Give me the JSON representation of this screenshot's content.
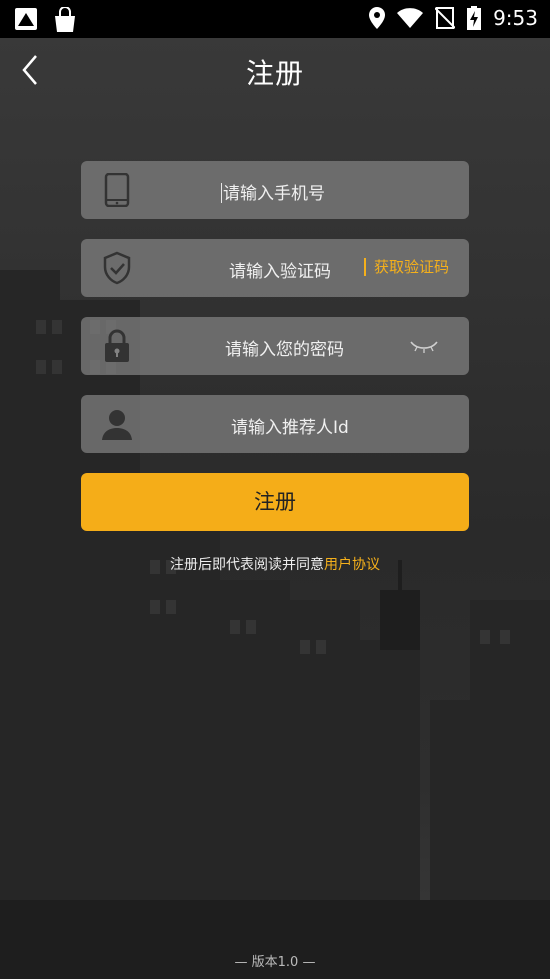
{
  "status_bar": {
    "time": "9:53",
    "left_icons": [
      "app-notification-icon",
      "shopping-bag-icon"
    ],
    "right_icons": [
      "location-icon",
      "wifi-icon",
      "no-sim-icon",
      "battery-charging-icon"
    ]
  },
  "header": {
    "title": "注册",
    "back_icon": "chevron-left-icon"
  },
  "form": {
    "phone": {
      "placeholder": "请输入手机号",
      "icon": "phone-icon"
    },
    "code": {
      "placeholder": "请输入验证码",
      "icon": "shield-icon",
      "get_code_label": "获取验证码"
    },
    "password": {
      "placeholder": "请输入您的密码",
      "icon": "lock-icon",
      "toggle_icon": "eye-closed-icon"
    },
    "referrer": {
      "placeholder": "请输入推荐人Id",
      "icon": "user-icon"
    },
    "submit_label": "注册"
  },
  "agreement": {
    "prefix": "注册后即代表阅读并同意",
    "link": "用户协议"
  },
  "footer": {
    "version": "— 版本1.0 —"
  },
  "colors": {
    "accent": "#f5ad18",
    "link": "#f5b01b",
    "field_bg": "#828282"
  }
}
